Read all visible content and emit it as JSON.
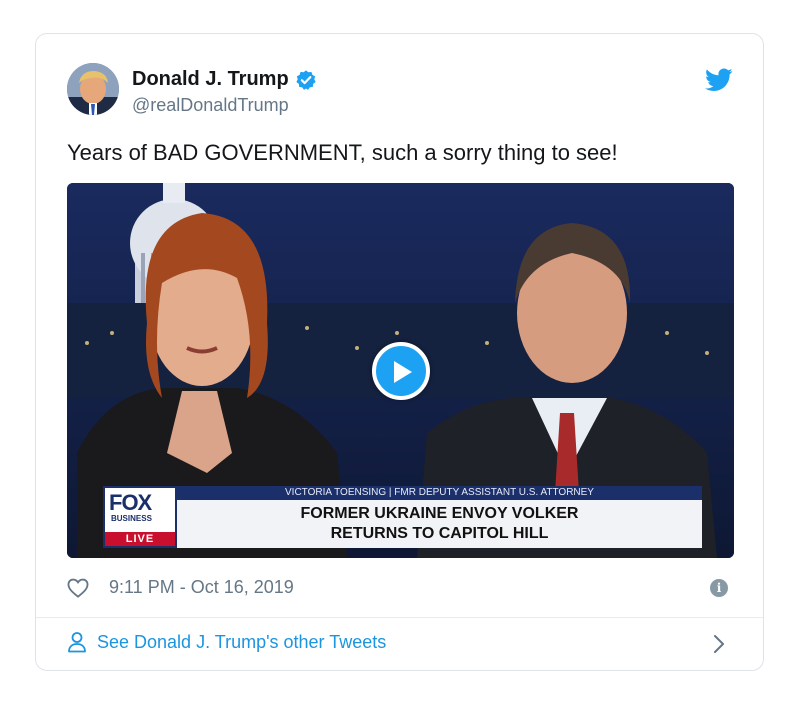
{
  "tweet": {
    "author_name": "Donald J. Trump",
    "handle": "@realDonaldTrump",
    "text": "Years of BAD GOVERNMENT, such a sorry thing to see!",
    "timestamp": "9:11 PM - Oct 16, 2019",
    "see_more": "See Donald J. Trump's other Tweets",
    "info_glyph": "i"
  },
  "video": {
    "network": "FOX",
    "network_sub": "BUSINESS",
    "live_label": "LIVE",
    "strap_top": "VICTORIA TOENSING | FMR DEPUTY ASSISTANT U.S. ATTORNEY",
    "headline_line1": "FORMER UKRAINE ENVOY VOLKER",
    "headline_line2": "RETURNS TO CAPITOL HILL"
  },
  "icons": {
    "verified": "verified-badge-icon",
    "twitter": "twitter-bird-icon",
    "like": "heart-icon",
    "info": "info-icon",
    "profile": "person-icon",
    "next": "chevron-right-icon",
    "play": "play-icon"
  },
  "colors": {
    "accent": "#1da1f2",
    "link": "#1b95e0",
    "muted": "#657786",
    "fox_navy": "#1b2f6b",
    "live_red": "#c8102e"
  }
}
